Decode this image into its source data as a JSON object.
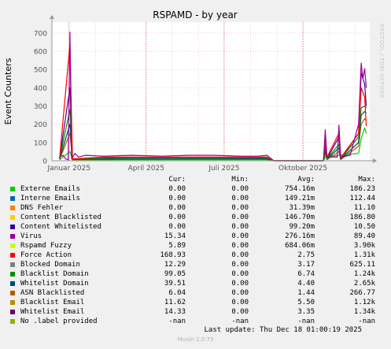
{
  "chart_data": {
    "type": "line",
    "title": "RSPAMD - by year",
    "ylabel": "Event Counters",
    "xlabel": "",
    "ylim": [
      0,
      760
    ],
    "yticks": [
      0,
      100,
      200,
      300,
      400,
      500,
      600,
      700
    ],
    "x_range": [
      "2024-12-12",
      "2025-12-18"
    ],
    "xticks": [
      {
        "label": "Januar 2025",
        "date": "2025-01-01"
      },
      {
        "label": "April 2025",
        "date": "2025-04-01"
      },
      {
        "label": "Juli 2025",
        "date": "2025-07-01"
      },
      {
        "label": "Oktober 2025",
        "date": "2025-10-01"
      }
    ],
    "grid": true,
    "legend_placement": "bottom",
    "series": [
      {
        "name": "Virus",
        "color": "#990099",
        "points": [
          [
            "2024-12-21",
            20
          ],
          [
            "2024-12-25",
            30
          ],
          [
            "2024-12-28",
            10
          ],
          [
            "2024-12-31",
            5
          ],
          [
            "2025-01-02",
            705
          ],
          [
            "2025-01-04",
            10
          ],
          [
            "2025-01-08",
            40
          ],
          [
            "2025-01-12",
            20
          ],
          [
            "2025-01-20",
            30
          ],
          [
            "2025-02-10",
            25
          ],
          [
            "2025-03-15",
            30
          ],
          [
            "2025-04-20",
            25
          ],
          [
            "2025-05-20",
            30
          ],
          [
            "2025-06-20",
            30
          ],
          [
            "2025-07-20",
            25
          ],
          [
            "2025-08-10",
            25
          ],
          [
            "2025-08-20",
            30
          ],
          [
            "2025-08-28",
            0
          ],
          [
            "2025-10-25",
            0
          ],
          [
            "2025-10-27",
            170
          ],
          [
            "2025-10-29",
            20
          ],
          [
            "2025-11-10",
            20
          ],
          [
            "2025-11-12",
            195
          ],
          [
            "2025-11-14",
            20
          ],
          [
            "2025-11-25",
            30
          ],
          [
            "2025-12-05",
            200
          ],
          [
            "2025-12-08",
            535
          ],
          [
            "2025-12-10",
            450
          ],
          [
            "2025-12-12",
            505
          ],
          [
            "2025-12-14",
            400
          ]
        ]
      },
      {
        "name": "Force Action",
        "color": "#ff0000",
        "points": [
          [
            "2024-12-21",
            15
          ],
          [
            "2025-01-02",
            640
          ],
          [
            "2025-01-05",
            10
          ],
          [
            "2025-02-10",
            20
          ],
          [
            "2025-05-10",
            20
          ],
          [
            "2025-08-20",
            20
          ],
          [
            "2025-08-28",
            0
          ],
          [
            "2025-10-25",
            0
          ],
          [
            "2025-10-27",
            120
          ],
          [
            "2025-10-29",
            20
          ],
          [
            "2025-11-12",
            150
          ],
          [
            "2025-11-14",
            15
          ],
          [
            "2025-12-05",
            150
          ],
          [
            "2025-12-08",
            400
          ],
          [
            "2025-12-12",
            350
          ],
          [
            "2025-12-14",
            190
          ]
        ]
      },
      {
        "name": "Blacklist Domain",
        "color": "#008f00",
        "points": [
          [
            "2024-12-21",
            15
          ],
          [
            "2025-01-02",
            280
          ],
          [
            "2025-01-05",
            10
          ],
          [
            "2025-03-10",
            15
          ],
          [
            "2025-06-10",
            15
          ],
          [
            "2025-08-20",
            15
          ],
          [
            "2025-08-28",
            0
          ],
          [
            "2025-10-25",
            0
          ],
          [
            "2025-10-27",
            90
          ],
          [
            "2025-10-29",
            10
          ],
          [
            "2025-11-12",
            90
          ],
          [
            "2025-11-14",
            10
          ],
          [
            "2025-12-05",
            130
          ],
          [
            "2025-12-08",
            290
          ],
          [
            "2025-12-12",
            300
          ],
          [
            "2025-12-14",
            290
          ]
        ]
      },
      {
        "name": "Whitelist Domain",
        "color": "#00455c",
        "points": [
          [
            "2024-12-21",
            10
          ],
          [
            "2025-01-02",
            200
          ],
          [
            "2025-01-05",
            8
          ],
          [
            "2025-04-10",
            10
          ],
          [
            "2025-07-10",
            10
          ],
          [
            "2025-08-20",
            10
          ],
          [
            "2025-08-28",
            0
          ],
          [
            "2025-10-25",
            0
          ],
          [
            "2025-10-27",
            60
          ],
          [
            "2025-10-29",
            8
          ],
          [
            "2025-11-12",
            70
          ],
          [
            "2025-11-14",
            8
          ],
          [
            "2025-12-05",
            100
          ],
          [
            "2025-12-08",
            250
          ],
          [
            "2025-12-12",
            270
          ],
          [
            "2025-12-14",
            260
          ]
        ]
      },
      {
        "name": "ASN Blacklisted",
        "color": "#b35a00",
        "points": [
          [
            "2024-12-21",
            8
          ],
          [
            "2025-01-02",
            150
          ],
          [
            "2025-01-05",
            6
          ],
          [
            "2025-05-10",
            8
          ],
          [
            "2025-08-20",
            8
          ],
          [
            "2025-08-28",
            0
          ],
          [
            "2025-10-25",
            0
          ],
          [
            "2025-10-27",
            40
          ],
          [
            "2025-10-29",
            6
          ],
          [
            "2025-11-12",
            50
          ],
          [
            "2025-11-14",
            6
          ],
          [
            "2025-12-05",
            80
          ],
          [
            "2025-12-08",
            200
          ],
          [
            "2025-12-12",
            230
          ],
          [
            "2025-12-14",
            220
          ]
        ]
      },
      {
        "name": "Externe Emails",
        "color": "#00cc00",
        "points": [
          [
            "2024-12-21",
            5
          ],
          [
            "2025-01-02",
            50
          ],
          [
            "2025-01-05",
            5
          ],
          [
            "2025-08-20",
            5
          ],
          [
            "2025-08-28",
            0
          ],
          [
            "2025-10-25",
            0
          ],
          [
            "2025-10-27",
            20
          ],
          [
            "2025-11-12",
            30
          ],
          [
            "2025-12-05",
            40
          ],
          [
            "2025-12-08",
            120
          ],
          [
            "2025-12-12",
            180
          ],
          [
            "2025-12-14",
            150
          ]
        ]
      },
      {
        "name": "Whitelist Email",
        "color": "#4b0082",
        "points": [
          [
            "2024-12-21",
            12
          ],
          [
            "2025-01-02",
            400
          ],
          [
            "2025-01-05",
            10
          ],
          [
            "2025-02-20",
            15
          ],
          [
            "2025-06-20",
            15
          ],
          [
            "2025-08-20",
            12
          ],
          [
            "2025-08-28",
            0
          ],
          [
            "2025-10-25",
            0
          ],
          [
            "2025-10-27",
            100
          ],
          [
            "2025-10-29",
            10
          ],
          [
            "2025-11-12",
            130
          ],
          [
            "2025-11-14",
            10
          ],
          [
            "2025-12-05",
            150
          ],
          [
            "2025-12-08",
            480
          ],
          [
            "2025-12-12",
            420
          ],
          [
            "2025-12-14",
            300
          ]
        ]
      }
    ],
    "legend": {
      "headers": [
        "Cur:",
        "Min:",
        "Avg:",
        "Max:"
      ],
      "rows": [
        {
          "name": "Externe Emails",
          "color": "#00cc00",
          "cur": "0.00",
          "min": "0.00",
          "avg": "754.16m",
          "max": "186.23"
        },
        {
          "name": "Interne Emails",
          "color": "#0066b3",
          "cur": "0.00",
          "min": "0.00",
          "avg": "149.21m",
          "max": "112.44"
        },
        {
          "name": "DNS Fehler",
          "color": "#ff8000",
          "cur": "0.00",
          "min": "0.00",
          "avg": "31.39m",
          "max": "11.10"
        },
        {
          "name": "Content Blacklisted",
          "color": "#ffcc00",
          "cur": "0.00",
          "min": "0.00",
          "avg": "146.70m",
          "max": "186.80"
        },
        {
          "name": "Content Whitelisted",
          "color": "#330099",
          "cur": "0.00",
          "min": "0.00",
          "avg": "99.20m",
          "max": "10.50"
        },
        {
          "name": "Virus",
          "color": "#990099",
          "cur": "15.34",
          "min": "0.00",
          "avg": "276.16m",
          "max": "89.40"
        },
        {
          "name": "Rspamd Fuzzy",
          "color": "#ccff00",
          "cur": "5.89",
          "min": "0.00",
          "avg": "684.06m",
          "max": "3.90k"
        },
        {
          "name": "Force Action",
          "color": "#ff0000",
          "cur": "168.93",
          "min": "0.00",
          "avg": "2.75",
          "max": "1.31k"
        },
        {
          "name": "Blocked Domain",
          "color": "#808080",
          "cur": "12.29",
          "min": "0.00",
          "avg": "3.17",
          "max": "625.11"
        },
        {
          "name": "Blacklist Domain",
          "color": "#008f00",
          "cur": "99.05",
          "min": "0.00",
          "avg": "6.74",
          "max": "1.24k"
        },
        {
          "name": "Whitelist Domain",
          "color": "#00487d",
          "cur": "39.51",
          "min": "0.00",
          "avg": "4.40",
          "max": "2.65k"
        },
        {
          "name": "ASN Blacklisted",
          "color": "#b35a00",
          "cur": "6.04",
          "min": "0.00",
          "avg": "1.44",
          "max": "266.77"
        },
        {
          "name": "Blacklist Email",
          "color": "#b38f00",
          "cur": "11.62",
          "min": "0.00",
          "avg": "5.50",
          "max": "1.12k"
        },
        {
          "name": "Whitelist Email",
          "color": "#6b006b",
          "cur": "14.33",
          "min": "0.00",
          "avg": "3.35",
          "max": "1.34k"
        },
        {
          "name": "No .label provided",
          "color": "#8fb300",
          "cur": "-nan",
          "min": "-nan",
          "avg": "-nan",
          "max": "-nan"
        }
      ]
    }
  },
  "footer": {
    "last_update": "Last update: Thu Dec 18 01:00:19 2025",
    "munin_version": "Munin 2.0.73"
  },
  "side_text": "RRDTOOL / TOBI OETIKER"
}
